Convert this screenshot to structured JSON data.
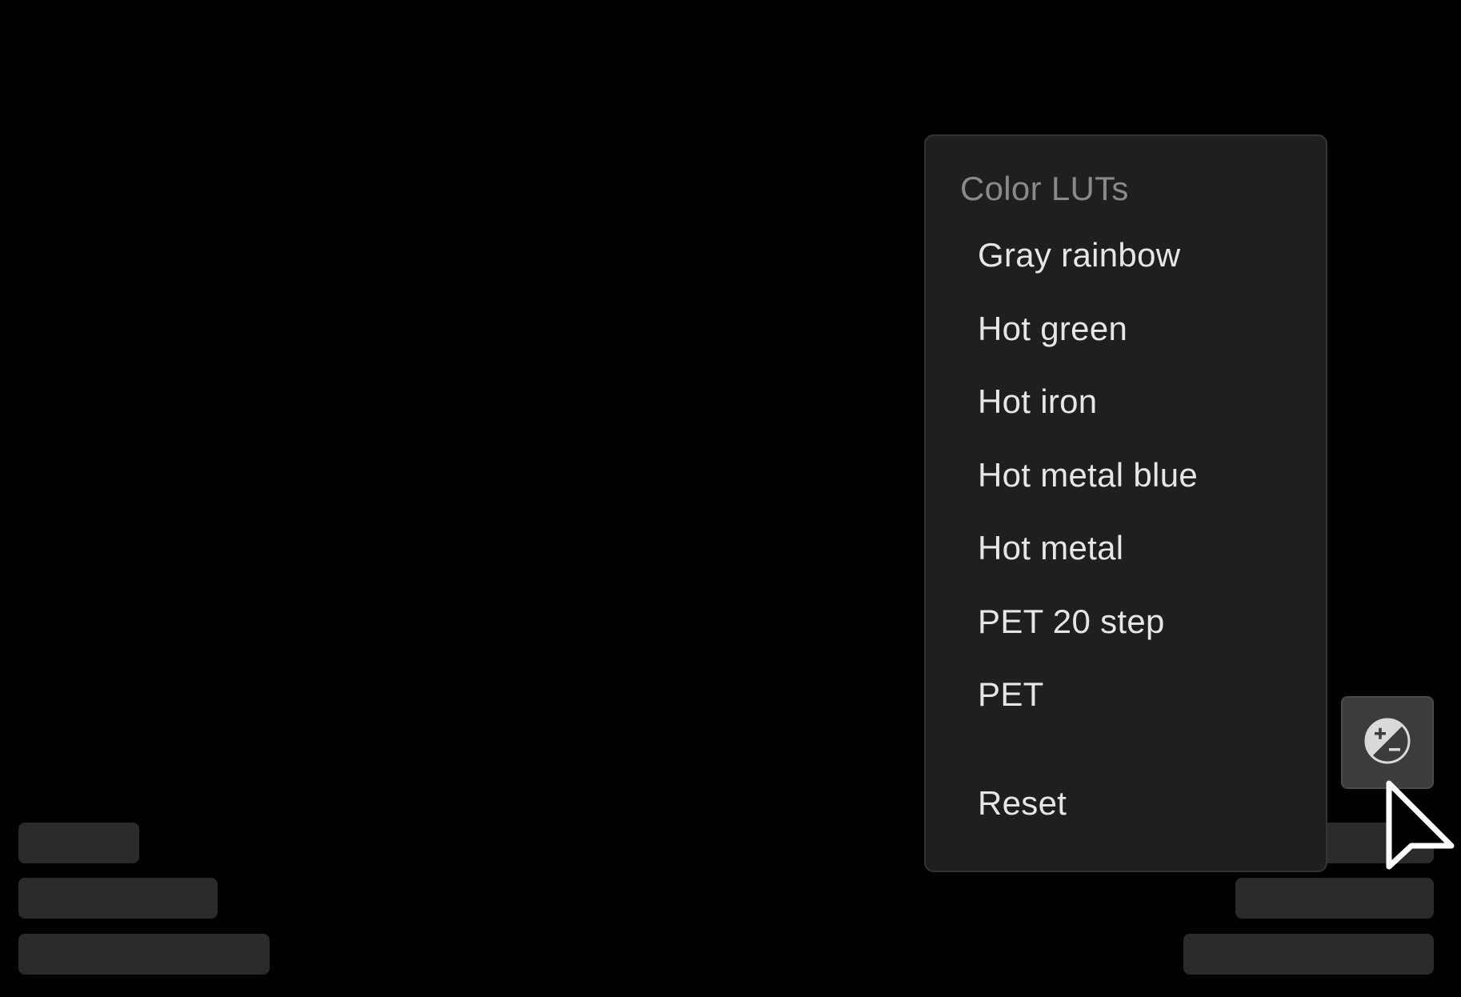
{
  "menu": {
    "header": "Color LUTs",
    "items": [
      {
        "label": "Gray rainbow"
      },
      {
        "label": "Hot green"
      },
      {
        "label": "Hot iron"
      },
      {
        "label": "Hot metal blue"
      },
      {
        "label": "Hot metal"
      },
      {
        "label": "PET 20 step"
      },
      {
        "label": "PET"
      }
    ],
    "reset": "Reset"
  },
  "toolbar": {
    "lut_button_icon": "exposure-plus-minus-icon"
  },
  "cursor": {
    "icon": "mouse-pointer-icon"
  },
  "colors": {
    "background": "#000000",
    "menu_background": "#1f1f1f",
    "menu_text": "#e6e6e6",
    "menu_header_text": "#8a8a8a",
    "button_background": "#3c3c3c",
    "placeholder": "#2b2b2b"
  }
}
